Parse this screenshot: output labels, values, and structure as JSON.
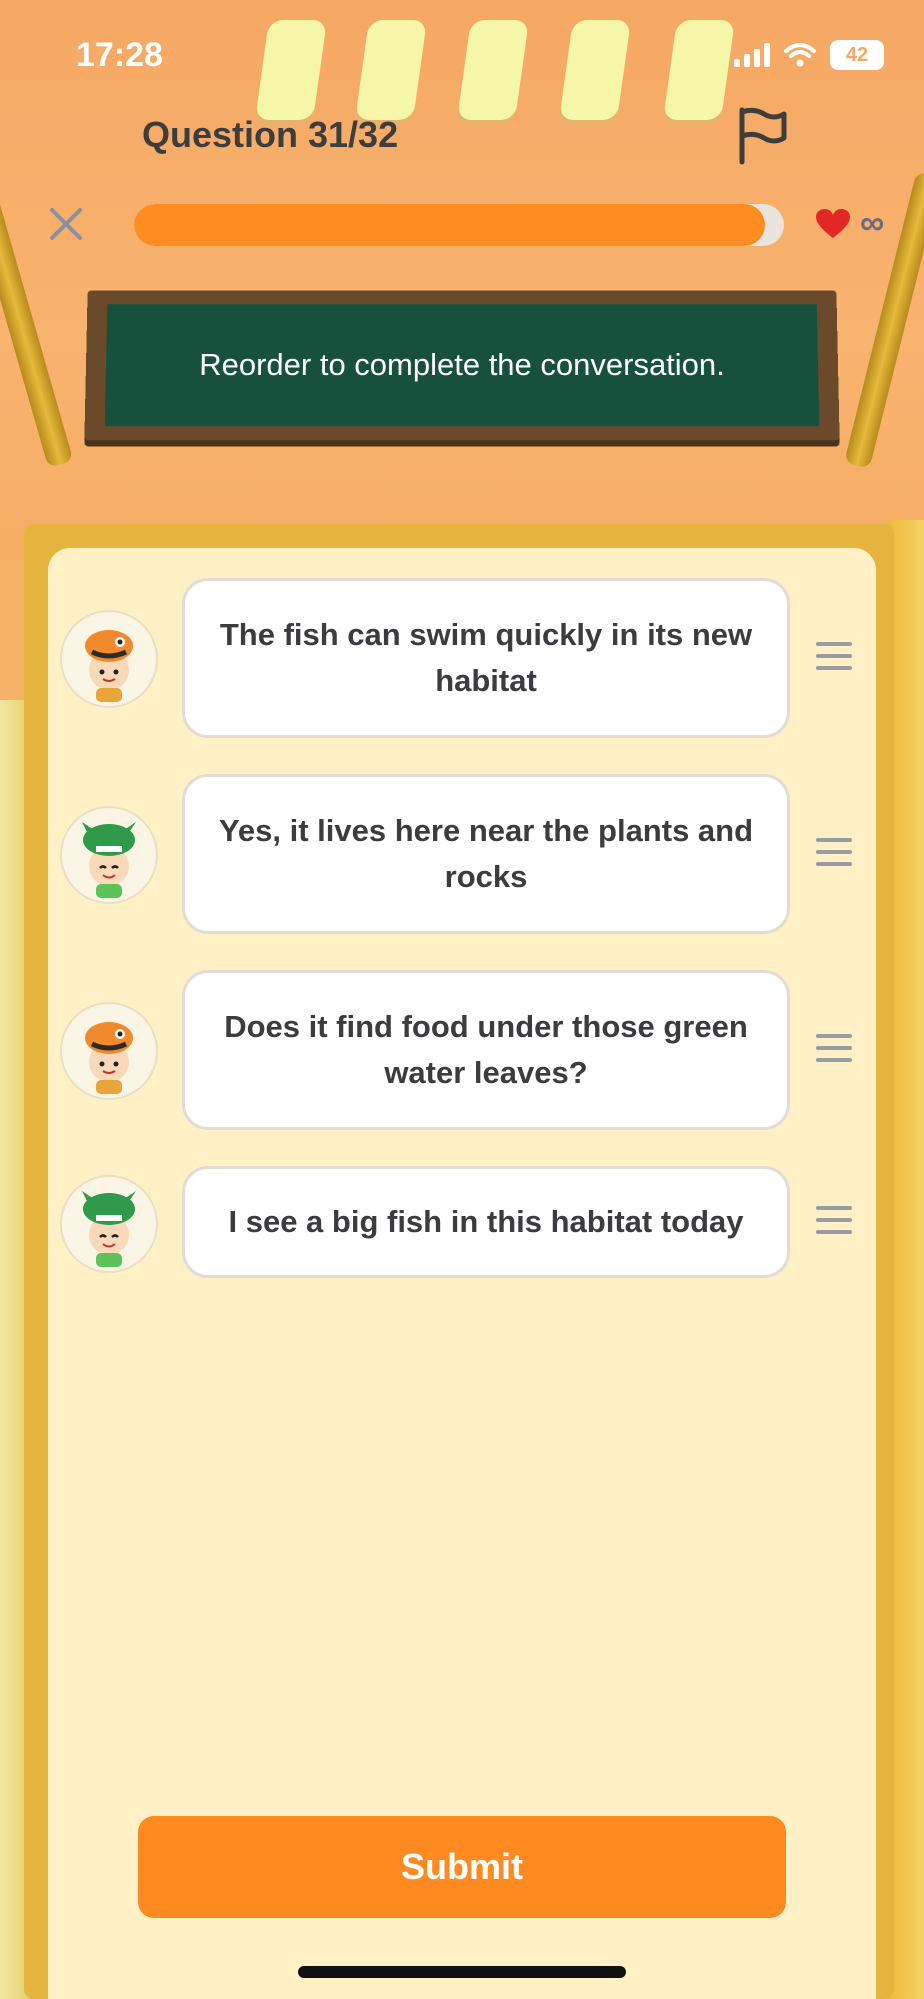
{
  "status_bar": {
    "time": "17:28",
    "battery": "42"
  },
  "header": {
    "question_label": "Question 31/32",
    "progress": 0.97,
    "lives": "∞"
  },
  "instruction": "Reorder to complete the conversation.",
  "messages": [
    {
      "text": "The fish can swim quickly in its new habitat",
      "speaker": "fish-hat-character"
    },
    {
      "text": "Yes, it lives here near the plants and rocks",
      "speaker": "dragon-hat-character"
    },
    {
      "text": "Does it find food under those green water leaves?",
      "speaker": "fish-hat-character"
    },
    {
      "text": "I see a big fish in this habitat today",
      "speaker": "dragon-hat-character"
    }
  ],
  "submit_label": "Submit",
  "colors": {
    "accent": "#ff8a1f",
    "board": "#17503c",
    "panel": "#fff1c5",
    "heart": "#e32626"
  }
}
